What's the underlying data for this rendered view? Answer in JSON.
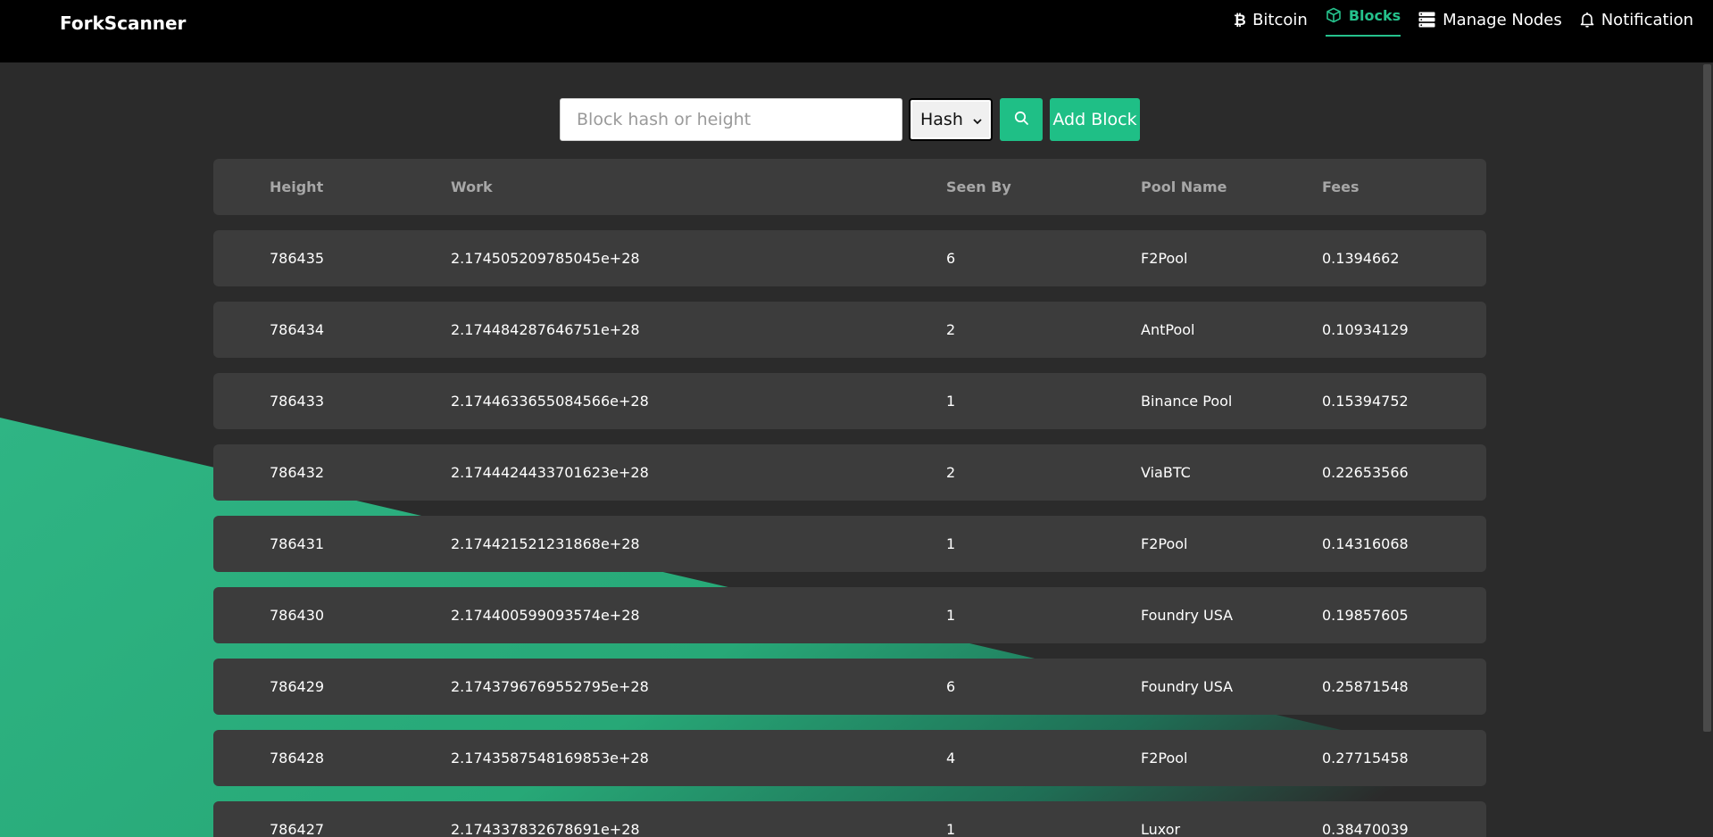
{
  "brand": "ForkScanner",
  "nav": [
    {
      "label": "Bitcoin",
      "icon": "bitcoin-icon",
      "active": false
    },
    {
      "label": "Blocks",
      "icon": "cube-icon",
      "active": true
    },
    {
      "label": "Manage Nodes",
      "icon": "server-icon",
      "active": false
    },
    {
      "label": "Notification",
      "icon": "bell-icon",
      "active": false
    }
  ],
  "search": {
    "placeholder": "Block hash or height",
    "value": "",
    "type_selected": "Hash",
    "search_icon": "search-icon",
    "add_label": "Add Block"
  },
  "table": {
    "headers": {
      "height": "Height",
      "work": "Work",
      "seen_by": "Seen By",
      "pool_name": "Pool Name",
      "fees": "Fees"
    },
    "rows": [
      {
        "height": "786435",
        "work": "2.174505209785045e+28",
        "seen_by": "6",
        "pool_name": "F2Pool",
        "fees": "0.1394662"
      },
      {
        "height": "786434",
        "work": "2.174484287646751e+28",
        "seen_by": "2",
        "pool_name": "AntPool",
        "fees": "0.10934129"
      },
      {
        "height": "786433",
        "work": "2.1744633655084566e+28",
        "seen_by": "1",
        "pool_name": "Binance Pool",
        "fees": "0.15394752"
      },
      {
        "height": "786432",
        "work": "2.1744424433701623e+28",
        "seen_by": "2",
        "pool_name": "ViaBTC",
        "fees": "0.22653566"
      },
      {
        "height": "786431",
        "work": "2.174421521231868e+28",
        "seen_by": "1",
        "pool_name": "F2Pool",
        "fees": "0.14316068"
      },
      {
        "height": "786430",
        "work": "2.174400599093574e+28",
        "seen_by": "1",
        "pool_name": "Foundry USA",
        "fees": "0.19857605"
      },
      {
        "height": "786429",
        "work": "2.1743796769552795e+28",
        "seen_by": "6",
        "pool_name": "Foundry USA",
        "fees": "0.25871548"
      },
      {
        "height": "786428",
        "work": "2.1743587548169853e+28",
        "seen_by": "4",
        "pool_name": "F2Pool",
        "fees": "0.27715458"
      },
      {
        "height": "786427",
        "work": "2.174337832678691e+28",
        "seen_by": "1",
        "pool_name": "Luxor",
        "fees": "0.38470039"
      }
    ]
  },
  "colors": {
    "accent": "#1fbf86",
    "navbar_bg": "#000000",
    "page_bg": "#2b2b2b",
    "row_bg": "#3c3c3c"
  }
}
